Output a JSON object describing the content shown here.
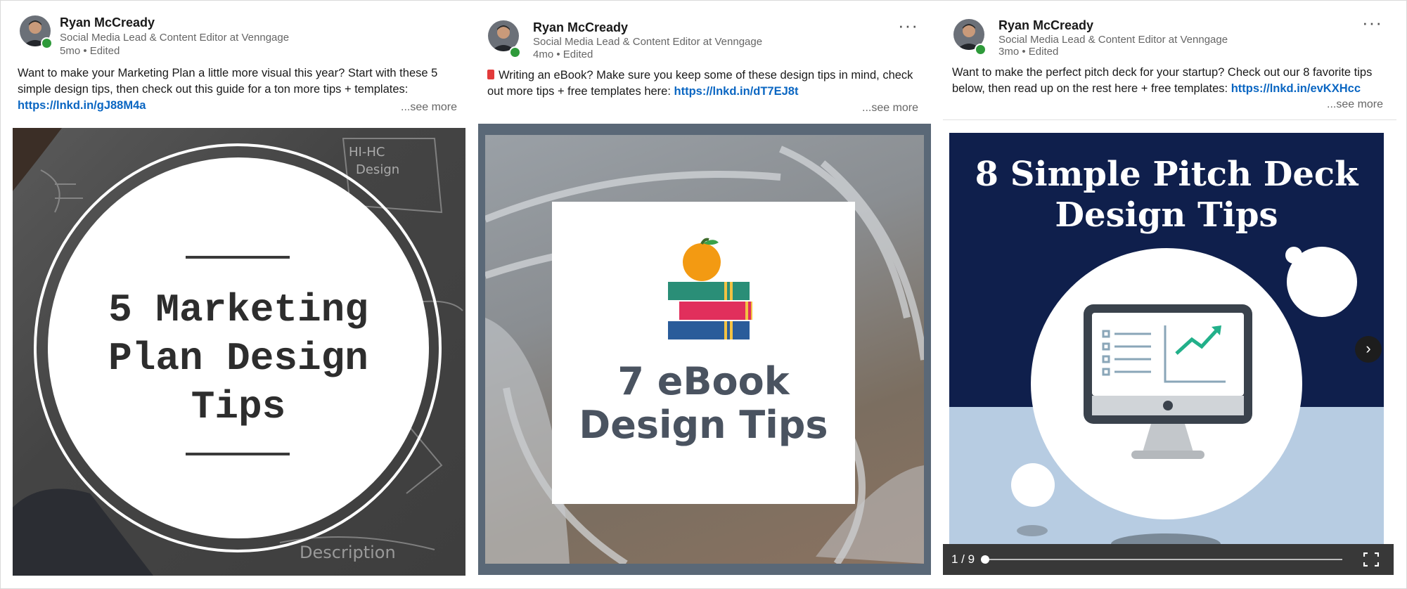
{
  "posts": [
    {
      "author": "Ryan McCready",
      "headline": "Social Media Lead & Content Editor at Venngage",
      "meta": "5mo • Edited",
      "text": "Want to make your Marketing Plan a little more visual this year? Start with these 5 simple design tips, then check out this guide for a ton more tips + templates:",
      "link": "https://lnkd.in/gJ88M4a",
      "see_more": "...see more",
      "image_title_lines": [
        "5 Marketing",
        "Plan Design",
        "Tips"
      ]
    },
    {
      "author": "Ryan McCready",
      "headline": "Social Media Lead & Content Editor at Venngage",
      "meta": "4mo • Edited",
      "text": "Writing an eBook? Make sure you keep some of these design tips in mind, check out more tips + free templates here:",
      "link": "https://lnkd.in/dT7EJ8t",
      "see_more": "...see more",
      "more_menu": "···",
      "image_title_lines": [
        "7 eBook",
        "Design Tips"
      ]
    },
    {
      "author": "Ryan McCready",
      "headline": "Social Media Lead & Content Editor at Venngage",
      "meta": "3mo • Edited",
      "text": "Want to make the perfect pitch deck for your startup? Check out our 8 favorite tips below, then read up on the rest here + free templates:",
      "link": "https://lnkd.in/evKXHcc",
      "see_more": "...see more",
      "more_menu": "···",
      "image_title_lines": [
        "8 Simple Pitch Deck",
        "Design Tips"
      ],
      "carousel": {
        "counter": "1 / 9",
        "current": 1,
        "total": 9,
        "next_icon": "chevron-right-icon",
        "fullscreen_icon": "fullscreen-icon"
      }
    }
  ],
  "colors": {
    "link": "#0a66c2",
    "online": "#2e9a3a",
    "deck_navy": "#0f1f4c"
  }
}
